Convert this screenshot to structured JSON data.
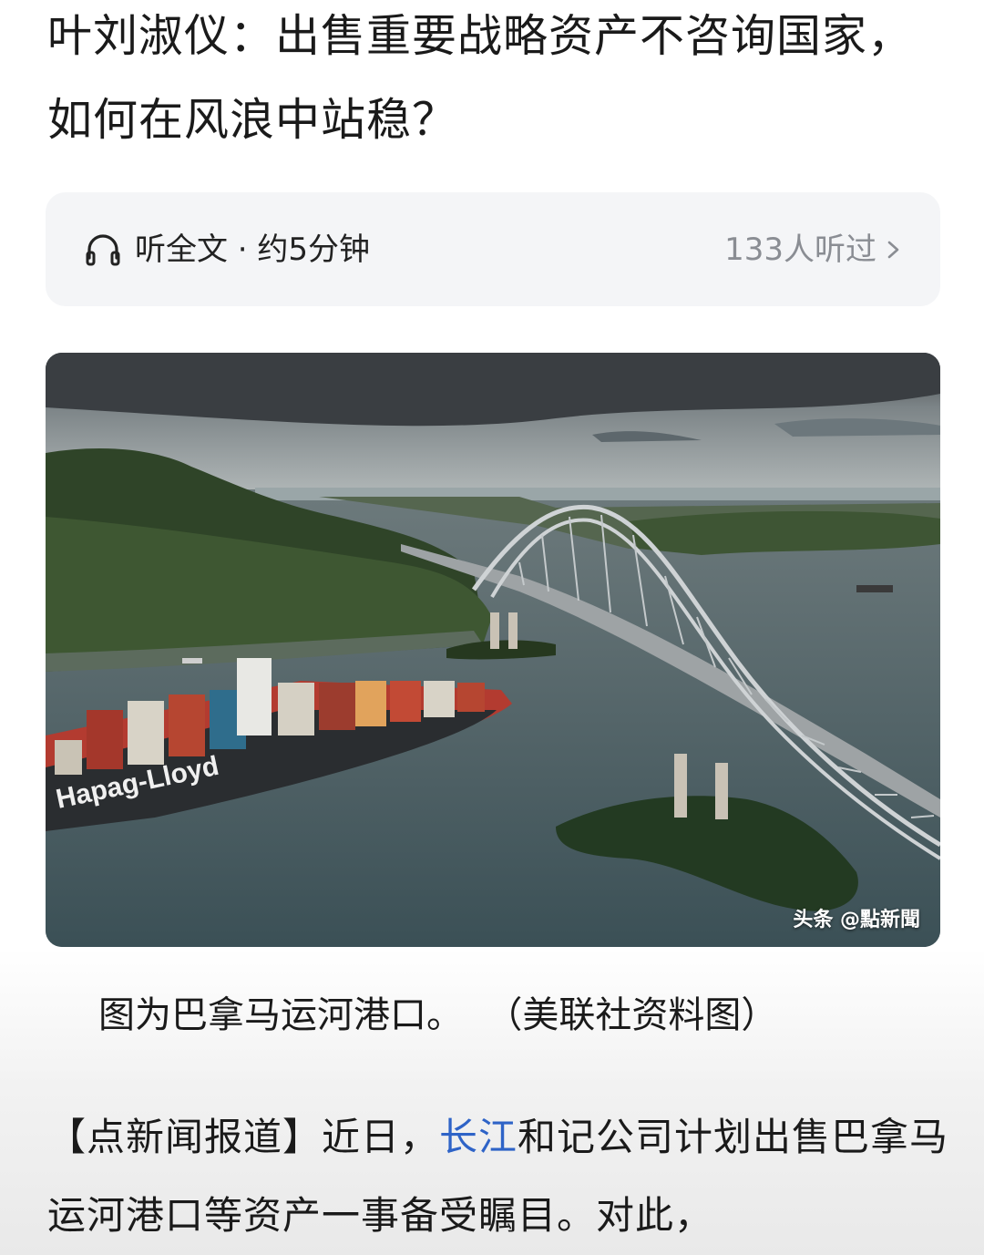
{
  "article": {
    "title": "叶刘淑仪：出售重要战略资产不咨询国家，如何在风浪中站稳？",
    "audio": {
      "label": "听全文 · 约5分钟",
      "listen_count": "133人听过",
      "icon": "headphones-icon"
    },
    "image": {
      "watermark": "头条 @點新聞",
      "ship_text": "Hapag-Lloyd"
    },
    "caption": "图为巴拿马运河港口。  （美联社资料图）",
    "body": {
      "prefix": "【点新闻报道】近日，",
      "link_text": "长江",
      "suffix": "和记公司计划出售巴拿马运河港口等资产一事备受瞩目。对此，"
    }
  },
  "colors": {
    "link": "#2e63c7",
    "text": "#1a1a1a",
    "muted": "#8a8d93",
    "audio_bg": "#f4f5f7"
  }
}
